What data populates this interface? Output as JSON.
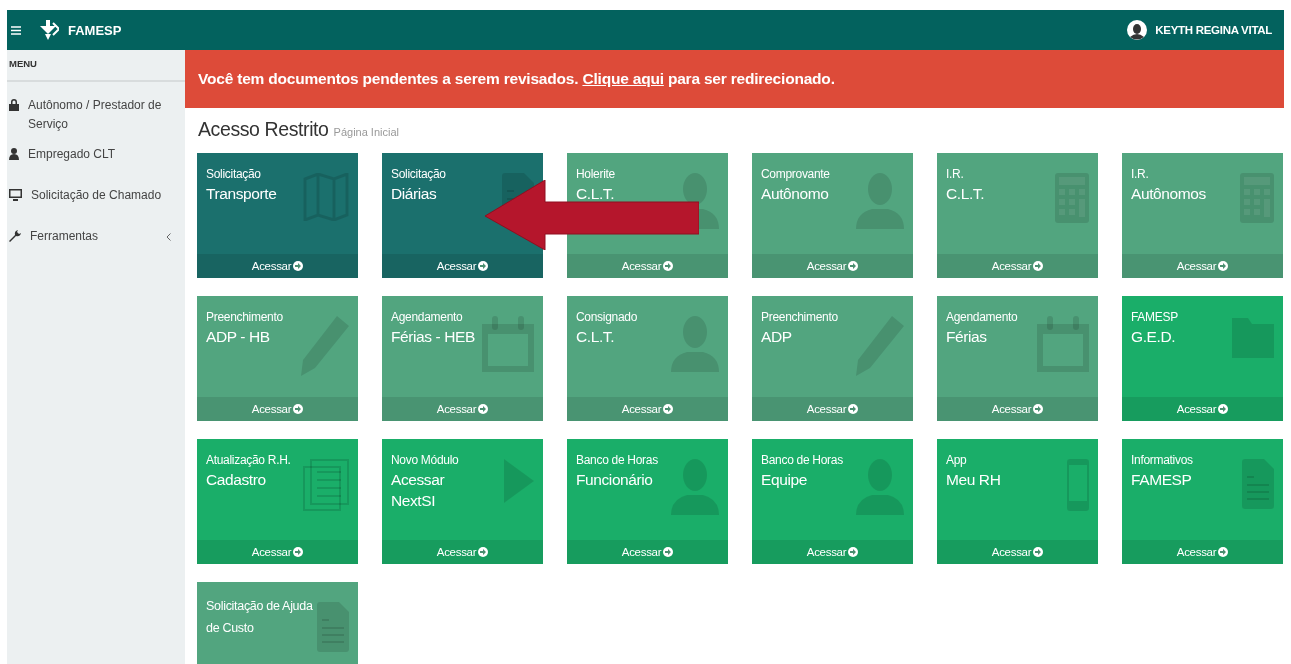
{
  "header": {
    "brand": "FAMESP",
    "user": "KEYTH REGINA VITAL"
  },
  "sidebar": {
    "heading": "MENU",
    "items": [
      {
        "label": "Autônomo / Prestador de Serviço",
        "kind": "lock",
        "submenu": false
      },
      {
        "label": "Empregado CLT",
        "kind": "user",
        "submenu": false
      },
      {
        "label": "Solicitação de Chamado",
        "kind": "monitor",
        "submenu": false
      },
      {
        "label": "Ferramentas",
        "kind": "wrench",
        "submenu": true
      }
    ]
  },
  "banner": {
    "text": "Você tem documentos pendentes a serem revisados. ",
    "link": "Clique aqui",
    "after": " para ser redirecionado."
  },
  "page": {
    "title": "Acesso Restrito",
    "subtitle": "Página Inicial"
  },
  "tiles": [
    {
      "label": "Solicitação",
      "title": "Transporte",
      "kind": "map",
      "color": "#1b706d",
      "link": "Acessar"
    },
    {
      "label": "Solicitação",
      "title": "Diárias",
      "kind": "document",
      "color": "#1b706d",
      "link": "Acessar"
    },
    {
      "label": "Holerite",
      "title": "C.L.T.",
      "kind": "person",
      "color": "#52a57f",
      "link": "Acessar"
    },
    {
      "label": "Comprovante",
      "title": "Autônomo",
      "kind": "person",
      "color": "#52a57f",
      "link": "Acessar"
    },
    {
      "label": "I.R.",
      "title": "C.L.T.",
      "kind": "calculator",
      "color": "#52a57f",
      "link": "Acessar"
    },
    {
      "label": "I.R.",
      "title": "Autônomos",
      "kind": "calculator",
      "color": "#52a57f",
      "link": "Acessar"
    },
    {
      "label": "Preenchimento",
      "title": "ADP - HB",
      "kind": "pencil",
      "color": "#52a57f",
      "link": "Acessar"
    },
    {
      "label": "Agendamento",
      "title": "Férias - HEB",
      "kind": "calendar",
      "color": "#52a57f",
      "link": "Acessar"
    },
    {
      "label": "Consignado",
      "title": "C.L.T.",
      "kind": "person",
      "color": "#52a57f",
      "link": "Acessar"
    },
    {
      "label": "Preenchimento",
      "title": "ADP",
      "kind": "pencil",
      "color": "#52a57f",
      "link": "Acessar"
    },
    {
      "label": "Agendamento",
      "title": "Férias",
      "kind": "calendar",
      "color": "#52a57f",
      "link": "Acessar"
    },
    {
      "label": "FAMESP",
      "title": "G.E.D.",
      "kind": "folder",
      "color": "#1aae69",
      "link": "Acessar"
    },
    {
      "label": "Atualização R.H.",
      "title": "Cadastro",
      "kind": "list",
      "color": "#1aae69",
      "link": "Acessar"
    },
    {
      "label": "Novo Módulo",
      "title": "Acessar NextSI",
      "kind": "play",
      "color": "#1aae69",
      "link": "Acessar"
    },
    {
      "label": "Banco de Horas",
      "title": "Funcionário",
      "kind": "person",
      "color": "#1aae69",
      "link": "Acessar"
    },
    {
      "label": "Banco de Horas",
      "title": "Equipe",
      "kind": "person",
      "color": "#1aae69",
      "link": "Acessar"
    },
    {
      "label": "App",
      "title": "Meu RH",
      "kind": "phone",
      "color": "#1aae69",
      "link": "Acessar"
    },
    {
      "label": "Informativos",
      "title": "FAMESP",
      "kind": "document",
      "color": "#1aae69",
      "link": "Acessar"
    },
    {
      "label": "Solicitação de Ajuda de Custo",
      "kind": "document",
      "color": "#52a57f"
    }
  ]
}
